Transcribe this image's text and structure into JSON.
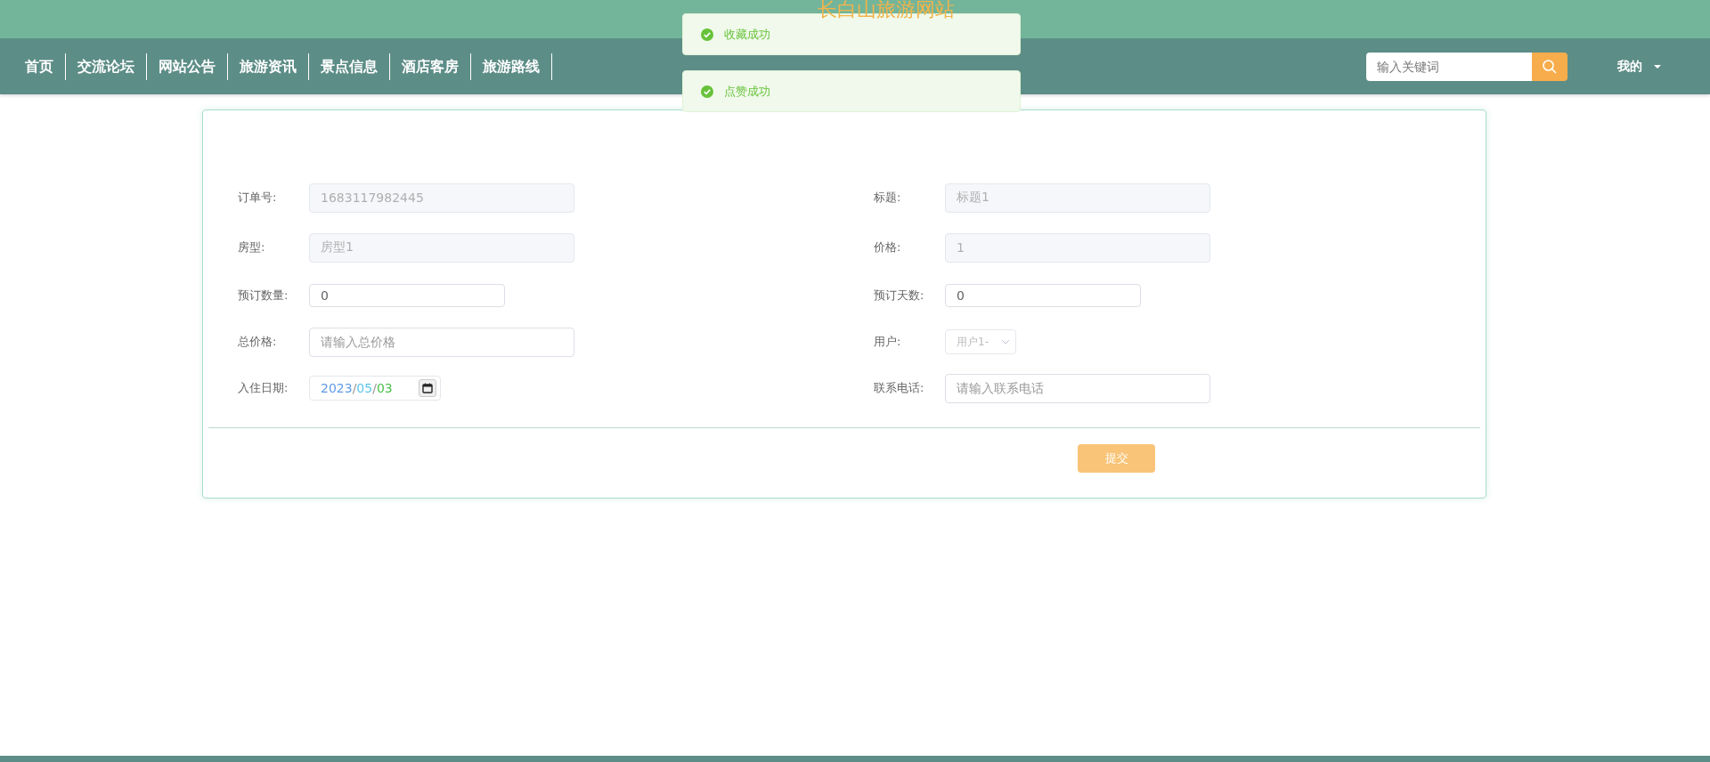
{
  "site_title": "长白山旅游网站",
  "nav": {
    "items": [
      {
        "label": "首页"
      },
      {
        "label": "交流论坛"
      },
      {
        "label": "网站公告"
      },
      {
        "label": "旅游资讯"
      },
      {
        "label": "景点信息"
      },
      {
        "label": "酒店客房"
      },
      {
        "label": "旅游路线"
      }
    ]
  },
  "search": {
    "placeholder": "输入关键词"
  },
  "user_menu": {
    "label": "我的"
  },
  "toasts": [
    {
      "message": "收藏成功"
    },
    {
      "message": "点赞成功"
    }
  ],
  "form": {
    "fields": [
      {
        "label": "订单号:",
        "kind": "text",
        "disabled": true,
        "value": "1683117982445"
      },
      {
        "label": "标题:",
        "kind": "text",
        "disabled": true,
        "value": "标题1"
      },
      {
        "label": "房型:",
        "kind": "text",
        "disabled": true,
        "value": "房型1"
      },
      {
        "label": "价格:",
        "kind": "text",
        "disabled": true,
        "value": "1"
      },
      {
        "label": "预订数量:",
        "kind": "number",
        "value": "0"
      },
      {
        "label": "预订天数:",
        "kind": "number",
        "value": "0"
      },
      {
        "label": "总价格:",
        "kind": "text",
        "placeholder": "请输入总价格"
      },
      {
        "label": "用户:",
        "kind": "select",
        "disabled": true,
        "value": "用户1-"
      },
      {
        "label": "入住日期:",
        "kind": "date",
        "value": "2023/05/03"
      },
      {
        "label": "联系电话:",
        "kind": "text",
        "placeholder": "请输入联系电话"
      }
    ],
    "submit": "提交"
  }
}
